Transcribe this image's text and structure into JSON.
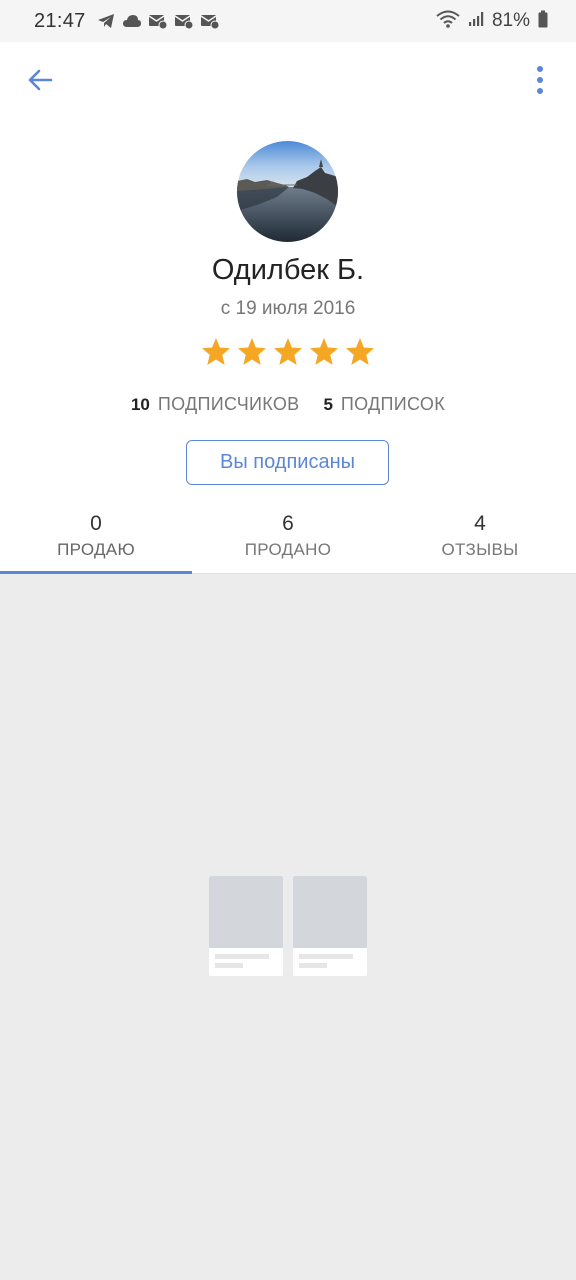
{
  "status_bar": {
    "time": "21:47",
    "battery_percent": "81%",
    "icons_left": [
      "telegram-icon",
      "cloud-icon",
      "mail-icon",
      "mail-icon",
      "mail-icon"
    ],
    "icons_right": [
      "wifi-icon",
      "signal-icon",
      "battery-icon"
    ]
  },
  "app_bar": {
    "back_icon": "arrow-back-icon",
    "menu_icon": "more-vert-icon",
    "accent_color": "#5c86d9"
  },
  "profile": {
    "name": "Одилбек Б.",
    "since": "с 19 июля 2016",
    "rating": 5,
    "rating_max": 5,
    "star_color": "#f5a623",
    "followers_count": "10",
    "followers_label": "ПОДПИСЧИКОВ",
    "following_count": "5",
    "following_label": "ПОДПИСОК",
    "subscribe_button_label": "Вы подписаны"
  },
  "tabs": [
    {
      "count": "0",
      "label": "ПРОДАЮ",
      "active": true
    },
    {
      "count": "6",
      "label": "ПРОДАНО",
      "active": false
    },
    {
      "count": "4",
      "label": "ОТЗЫВЫ",
      "active": false
    }
  ],
  "content": {
    "state": "empty",
    "background_color": "#ececec"
  }
}
